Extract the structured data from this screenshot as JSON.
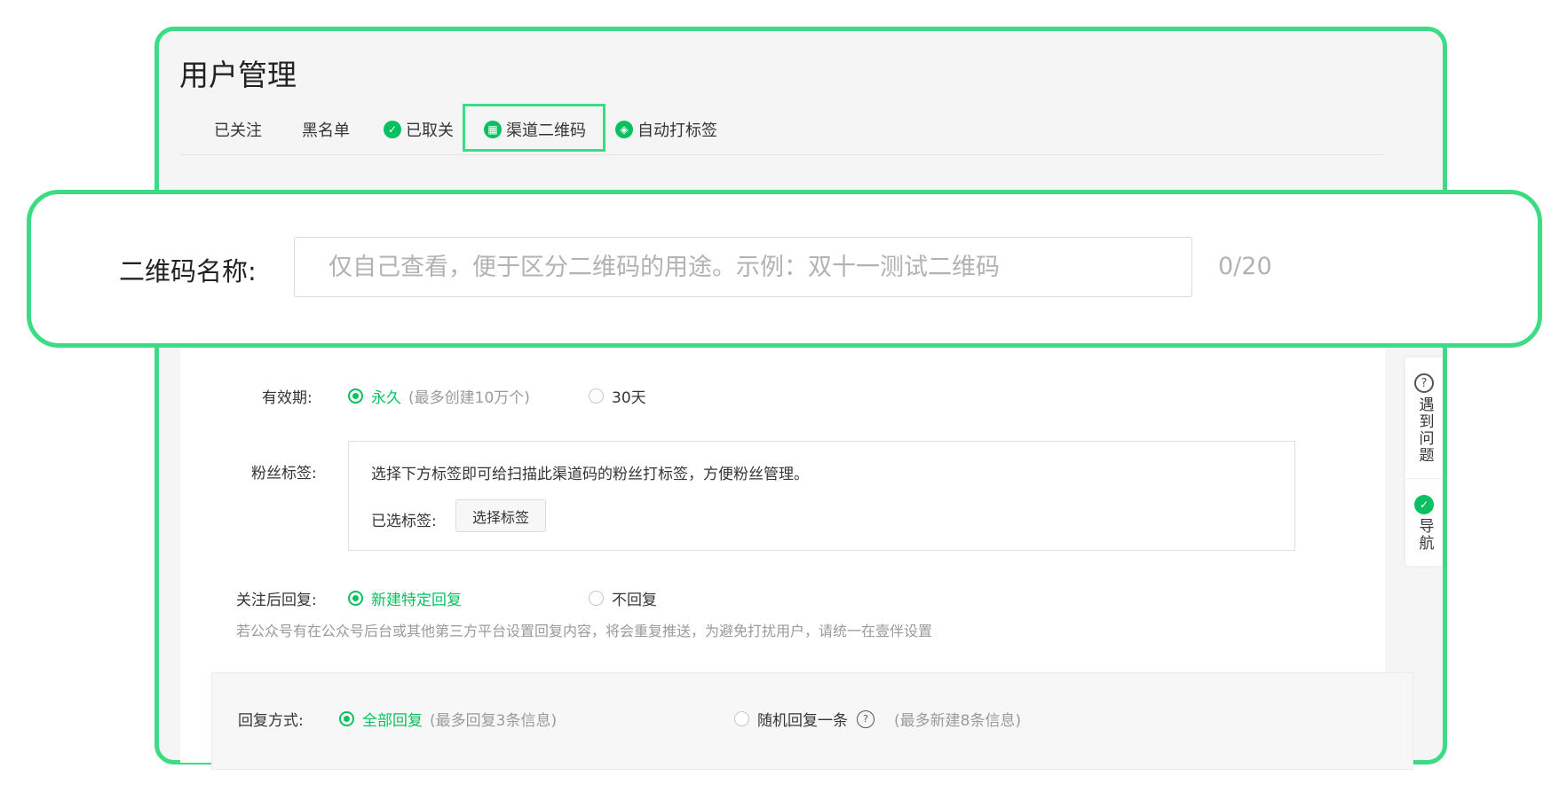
{
  "page_title": "用户管理",
  "tabs": [
    {
      "label": "已关注",
      "icon": ""
    },
    {
      "label": "黑名单",
      "icon": ""
    },
    {
      "label": "已取关",
      "icon": "badge-icon"
    },
    {
      "label": "渠道二维码",
      "icon": "qrcode-icon"
    },
    {
      "label": "自动打标签",
      "icon": "tag-icon"
    }
  ],
  "active_tab": "渠道二维码",
  "form": {
    "qr_name_label": "二维码名称:",
    "qr_name_placeholder": "仅自己查看，便于区分二维码的用途。示例：双十一测试二维码",
    "qr_name_count": "0/20",
    "validity_label": "有效期:",
    "validity_permanent": "永久",
    "validity_permanent_note": "(最多创建10万个)",
    "validity_30": "30天",
    "fan_tag_label": "粉丝标签:",
    "fan_tag_hint": "选择下方标签即可给扫描此渠道码的粉丝打标签，方便粉丝管理。",
    "selected_tags_label": "已选标签:",
    "choose_tags_button": "选择标签",
    "follow_reply_label": "关注后回复:",
    "follow_reply_new": "新建特定回复",
    "follow_reply_none": "不回复",
    "follow_reply_tip": "若公众号有在公众号后台或其他第三方平台设置回复内容，将会重复推送，为避免打扰用户，请统一在壹伴设置",
    "reply_mode_label": "回复方式:",
    "reply_all": "全部回复",
    "reply_all_note": "(最多回复3条信息)",
    "reply_random": "随机回复一条",
    "reply_random_note": "(最多新建8条信息)"
  },
  "side_tools": {
    "help": "遇到问题",
    "nav": "导航"
  },
  "colors": {
    "accent": "#07c160",
    "highlight": "#3ddc84"
  }
}
